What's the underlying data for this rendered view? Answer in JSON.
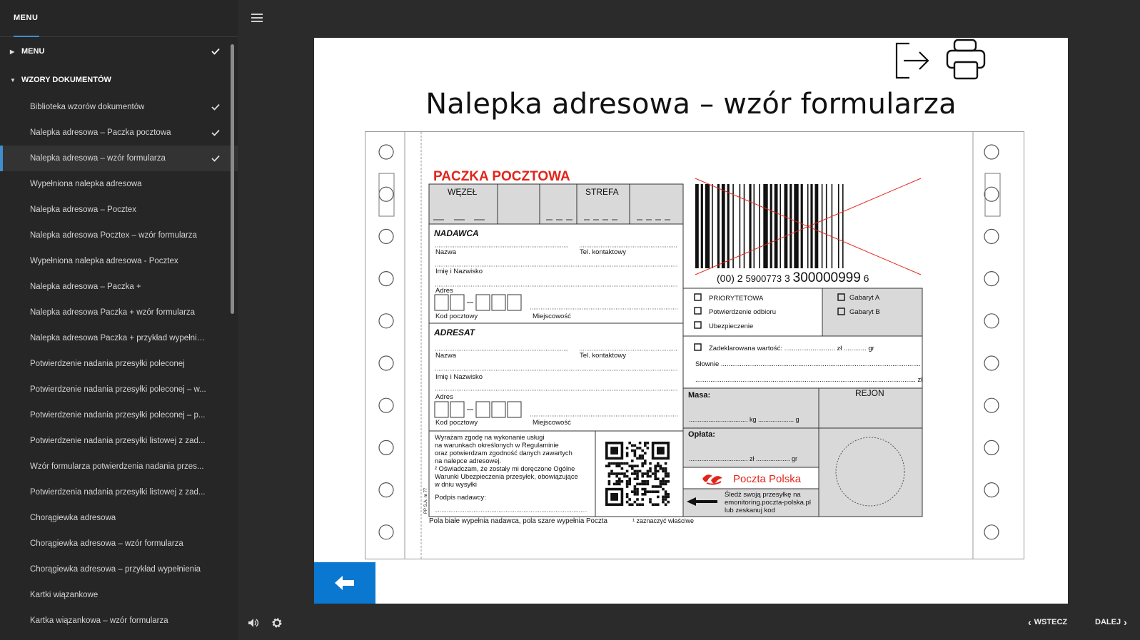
{
  "sidebar": {
    "header": "MENU",
    "sections": [
      {
        "label": "MENU",
        "checked": true
      },
      {
        "label": "WZORY DOKUMENTÓW",
        "checked": false
      }
    ],
    "items": [
      {
        "label": "Biblioteka wzorów dokumentów",
        "checked": true
      },
      {
        "label": "Nalepka adresowa – Paczka pocztowa",
        "checked": true
      },
      {
        "label": "Nalepka adresowa – wzór formularza",
        "checked": true
      },
      {
        "label": "Wypełniona nalepka adresowa",
        "checked": false
      },
      {
        "label": "Nalepka adresowa – Pocztex",
        "checked": false
      },
      {
        "label": "Nalepka adresowa Pocztex – wzór formularza",
        "checked": false
      },
      {
        "label": "Wypełniona nalepka adresowa - Pocztex",
        "checked": false
      },
      {
        "label": "Nalepka adresowa – Paczka +",
        "checked": false
      },
      {
        "label": "Nalepka adresowa Paczka + wzór formularza",
        "checked": false
      },
      {
        "label": "Nalepka adresowa Paczka + przykład wypełnie...",
        "checked": false
      },
      {
        "label": "Potwierdzenie nadania przesyłki poleconej",
        "checked": false
      },
      {
        "label": "Potwierdzenie nadania przesyłki poleconej – w...",
        "checked": false
      },
      {
        "label": "Potwierdzenie nadania przesyłki poleconej – p...",
        "checked": false
      },
      {
        "label": "Potwierdzenie nadania przesyłki listowej z zad...",
        "checked": false
      },
      {
        "label": "Wzór formularza potwierdzenia nadania przes...",
        "checked": false
      },
      {
        "label": "Potwierdzenia nadania przesyłki listowej z zad...",
        "checked": false
      },
      {
        "label": "Chorągiewka adresowa",
        "checked": false
      },
      {
        "label": "Chorągiewka adresowa – wzór formularza",
        "checked": false
      },
      {
        "label": "Chorągiewka adresowa – przykład wypełnienia",
        "checked": false
      },
      {
        "label": "Kartki wiązankowe",
        "checked": false
      },
      {
        "label": "Kartka wiązankowa – wzór formularza",
        "checked": false
      }
    ]
  },
  "content": {
    "title": "Nalepka adresowa – wzór formularza"
  },
  "form": {
    "heading": "PACZKA POCZTOWA",
    "wezel": "WĘZEŁ",
    "strefa": "STREFA",
    "nadawca": "NADAWCA",
    "adresat": "ADRESAT",
    "nazwa": "Nazwa",
    "tel": "Tel. kontaktowy",
    "imie": "Imię i Nazwisko",
    "adres": "Adres",
    "kod": "Kod pocztowy",
    "miejscowosc": "Miejscowość",
    "barcode_prefix": "(00) 2",
    "barcode_mid1": "5900773",
    "barcode_mid2": "3",
    "barcode_mid3": "300000999",
    "barcode_end": "6",
    "priorytetowa": "PRIORYTETOWA",
    "potwierdzenie": "Potwierdzenie odbioru",
    "ubezpieczenie": "Ubezpieczenie",
    "gabarytA": "Gabaryt A",
    "gabarytB": "Gabaryt B",
    "zadeklarowana": "Zadeklarowana wartość: ........................... zł ............ gr",
    "slownie": "Słownie ..........................................................................................................",
    "slownie2": "..................................................................................................................... zł",
    "masa": "Masa:",
    "masa_line": "................................. kg .................... g",
    "rejon": "REJON",
    "oplata": "Opłata:",
    "oplata_line": "................................. zł ................... gr",
    "poczta_polska": "Poczta Polska",
    "sledz1": "Śledź swoją przesyłkę na",
    "sledz2": "emonitoring.poczta-polska.pl",
    "sledz3": "lub zeskanuj kod",
    "zgoda1": "Wyrażam zgodę na wykonanie usługi",
    "zgoda2": "na warunkach określonych w Regulaminie",
    "zgoda3": "oraz potwierdzam zgodność danych zawartych",
    "zgoda4": "na nalepce adresowej.",
    "zgoda5": "² Oświadczam, że zostały mi doręczone Ogólne",
    "zgoda6": "Warunki Ubezpieczenia przesyłek, obowiązujące",
    "zgoda7": "w dniu wysyłki",
    "podpis": "Podpis nadawcy:",
    "ppsa": "PP S.A. nr 77",
    "footer": "Pola białe wypełnia nadawca, pola szare wypełnia Poczta",
    "footer_note": "¹ zaznaczyć właściwe"
  },
  "nav": {
    "prev": "WSTECZ",
    "next": "DALEJ"
  },
  "colors": {
    "accent": "#3e8ed0",
    "back_button": "#0a78d0",
    "poczta_red": "#e1251b"
  }
}
